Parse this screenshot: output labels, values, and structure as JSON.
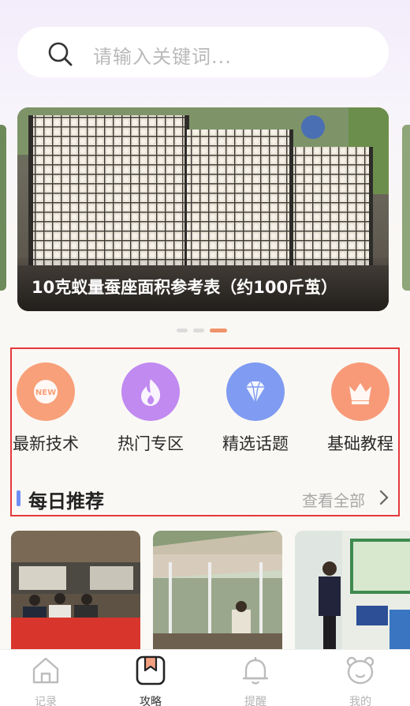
{
  "search": {
    "placeholder": "请输入关键词..."
  },
  "banner": {
    "caption": "10克蚁量蚕座面积参考表（约100斤茧）",
    "page_count": 3,
    "active_page": 3
  },
  "categories": [
    {
      "label": "最新技术",
      "icon": "new-badge-icon",
      "color": "#f8a07a",
      "badge": "NEW"
    },
    {
      "label": "热门专区",
      "icon": "flame-icon",
      "color": "#c08af1"
    },
    {
      "label": "精选话题",
      "icon": "diamond-icon",
      "color": "#7f9bf2"
    },
    {
      "label": "基础教程",
      "icon": "crown-icon",
      "color": "#f89a78"
    }
  ],
  "recommend": {
    "title": "每日推荐",
    "more": "查看全部"
  },
  "tabs": [
    {
      "label": "记录",
      "icon": "home-icon",
      "active": false
    },
    {
      "label": "攻略",
      "icon": "bookmark-icon",
      "active": true
    },
    {
      "label": "提醒",
      "icon": "bell-icon",
      "active": false
    },
    {
      "label": "我的",
      "icon": "bear-face-icon",
      "active": false
    }
  ],
  "colors": {
    "accent": "#f0936a",
    "highlight_border": "#e5393b",
    "section_bar": "#6f8ff4"
  }
}
